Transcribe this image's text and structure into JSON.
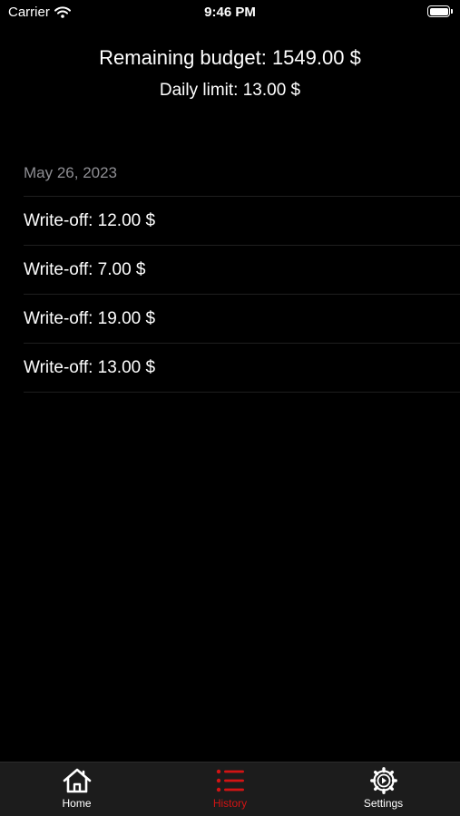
{
  "status_bar": {
    "carrier": "Carrier",
    "time": "9:46 PM"
  },
  "header": {
    "remaining_budget": "Remaining budget: 1549.00 $",
    "daily_limit": "Daily limit: 13.00 $"
  },
  "history": {
    "section_date": "May 26, 2023",
    "items": [
      {
        "label": "Write-off: 12.00 $"
      },
      {
        "label": "Write-off: 7.00 $"
      },
      {
        "label": "Write-off: 19.00 $"
      },
      {
        "label": "Write-off: 13.00 $"
      }
    ]
  },
  "tab_bar": {
    "tabs": [
      {
        "label": "Home",
        "icon": "house-icon",
        "active": false
      },
      {
        "label": "History",
        "icon": "list-icon",
        "active": true
      },
      {
        "label": "Settings",
        "icon": "gear-icon",
        "active": false
      }
    ]
  },
  "colors": {
    "background": "#000000",
    "accent": "#d21414",
    "secondary_text": "#8e8e93",
    "tab_bar_background": "#1c1c1c"
  }
}
